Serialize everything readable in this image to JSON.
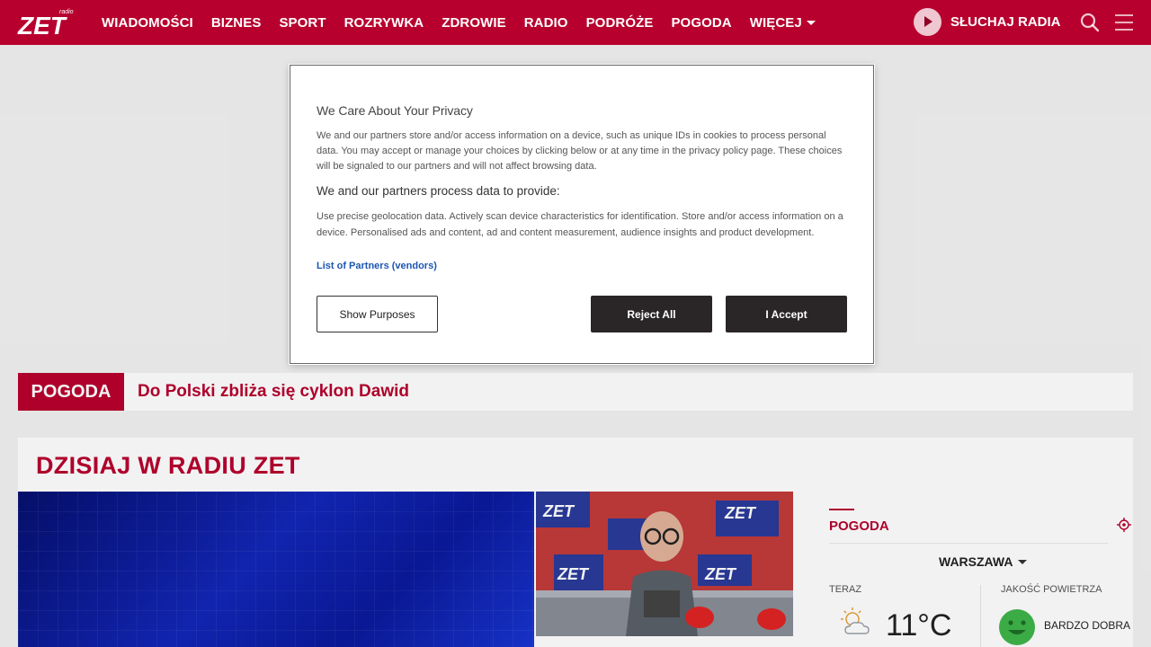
{
  "header": {
    "logo_text": "ZET",
    "logo_small": "radio",
    "nav": [
      "WIADOMOŚCI",
      "BIZNES",
      "SPORT",
      "ROZRYWKA",
      "ZDROWIE",
      "RADIO",
      "PODRÓŻE",
      "POGODA"
    ],
    "more_label": "WIĘCEJ",
    "listen_label": "SŁUCHAJ RADIA"
  },
  "ticker": {
    "tag": "POGODA",
    "headline": "Do Polski zbliża się cyklon Dawid"
  },
  "today": {
    "title": "DZISIAJ W RADIU ZET"
  },
  "weather": {
    "title": "POGODA",
    "city": "WARSZAWA",
    "now_label": "TERAZ",
    "temperature": "11°C",
    "air_quality_label": "JAKOŚĆ POWIETRZA",
    "air_quality_value": "BARDZO DOBRA"
  },
  "consent": {
    "title": "We Care About Your Privacy",
    "intro": "We and our partners store and/or access information on a device, such as unique IDs in cookies to process personal data. You may accept or manage your choices by clicking below or at any time in the privacy policy page. These choices will be signaled to our partners and will not affect browsing data.",
    "purposes_heading": "We and our partners process data to provide:",
    "purposes_text": "Use precise geolocation data. Actively scan device characteristics for identification. Store and/or access information on a device. Personalised ads and content, ad and content measurement, audience insights and product development.",
    "vendors_link": "List of Partners (vendors)",
    "show_purposes": "Show Purposes",
    "reject_all": "Reject All",
    "accept": "I Accept"
  },
  "colors": {
    "brand": "#b8002e",
    "button_dark": "#2a2627",
    "link": "#1b56b3"
  }
}
